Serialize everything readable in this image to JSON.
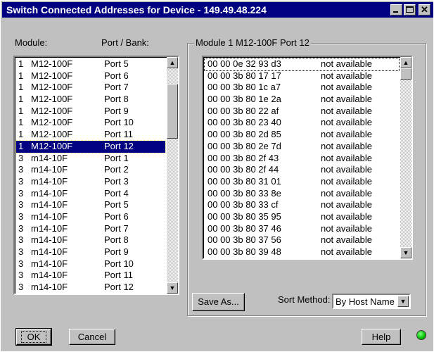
{
  "window": {
    "title": "Switch Connected Addresses for Device - 149.49.48.224"
  },
  "left": {
    "header_module": "Module:",
    "header_port": "Port / Bank:",
    "rows": [
      {
        "num": "1",
        "module": "M12-100F",
        "port": "Port 5"
      },
      {
        "num": "1",
        "module": "M12-100F",
        "port": "Port 6"
      },
      {
        "num": "1",
        "module": "M12-100F",
        "port": "Port 7"
      },
      {
        "num": "1",
        "module": "M12-100F",
        "port": "Port 8"
      },
      {
        "num": "1",
        "module": "M12-100F",
        "port": "Port 9"
      },
      {
        "num": "1",
        "module": "M12-100F",
        "port": "Port 10"
      },
      {
        "num": "1",
        "module": "M12-100F",
        "port": "Port 11"
      },
      {
        "num": "1",
        "module": "M12-100F",
        "port": "Port 12",
        "selected": true
      },
      {
        "num": "3",
        "module": "m14-10F",
        "port": "Port 1"
      },
      {
        "num": "3",
        "module": "m14-10F",
        "port": "Port 2"
      },
      {
        "num": "3",
        "module": "m14-10F",
        "port": "Port 3"
      },
      {
        "num": "3",
        "module": "m14-10F",
        "port": "Port 4"
      },
      {
        "num": "3",
        "module": "m14-10F",
        "port": "Port 5"
      },
      {
        "num": "3",
        "module": "m14-10F",
        "port": "Port 6"
      },
      {
        "num": "3",
        "module": "m14-10F",
        "port": "Port 7"
      },
      {
        "num": "3",
        "module": "m14-10F",
        "port": "Port 8"
      },
      {
        "num": "3",
        "module": "m14-10F",
        "port": "Port 9"
      },
      {
        "num": "3",
        "module": "m14-10F",
        "port": "Port 10"
      },
      {
        "num": "3",
        "module": "m14-10F",
        "port": "Port 11"
      },
      {
        "num": "3",
        "module": "m14-10F",
        "port": "Port 12"
      }
    ]
  },
  "right": {
    "group_title": "Module 1 M12-100F Port 12",
    "rows": [
      {
        "mac": "00 00 0e 32 93 d3",
        "host": "not available",
        "selected": true
      },
      {
        "mac": "00 00 3b 80 17 17",
        "host": "not available"
      },
      {
        "mac": "00 00 3b 80 1c a7",
        "host": "not available"
      },
      {
        "mac": "00 00 3b 80 1e 2a",
        "host": "not available"
      },
      {
        "mac": "00 00 3b 80 22 af",
        "host": "not available"
      },
      {
        "mac": "00 00 3b 80 23 40",
        "host": "not available"
      },
      {
        "mac": "00 00 3b 80 2d 85",
        "host": "not available"
      },
      {
        "mac": "00 00 3b 80 2e 7d",
        "host": "not available"
      },
      {
        "mac": "00 00 3b 80 2f 43",
        "host": "not available"
      },
      {
        "mac": "00 00 3b 80 2f 44",
        "host": "not available"
      },
      {
        "mac": "00 00 3b 80 31 01",
        "host": "not available"
      },
      {
        "mac": "00 00 3b 80 33 8e",
        "host": "not available"
      },
      {
        "mac": "00 00 3b 80 33 cf",
        "host": "not available"
      },
      {
        "mac": "00 00 3b 80 35 95",
        "host": "not available"
      },
      {
        "mac": "00 00 3b 80 37 46",
        "host": "not available"
      },
      {
        "mac": "00 00 3b 80 37 56",
        "host": "not available"
      },
      {
        "mac": "00 00 3b 80 39 48",
        "host": "not available"
      }
    ],
    "save_as": "Save As...",
    "sort_label": "Sort Method:",
    "sort_value": "By Host Name"
  },
  "footer": {
    "ok": "OK",
    "cancel": "Cancel",
    "help": "Help"
  },
  "icons": {
    "scroll_up": "up-arrow-icon",
    "scroll_down": "down-arrow-icon",
    "dropdown": "dropdown-arrow-icon",
    "status": "status-led-icon"
  },
  "colors": {
    "titlebar": "#000080",
    "selection": "#000080",
    "led": "#00c000"
  }
}
